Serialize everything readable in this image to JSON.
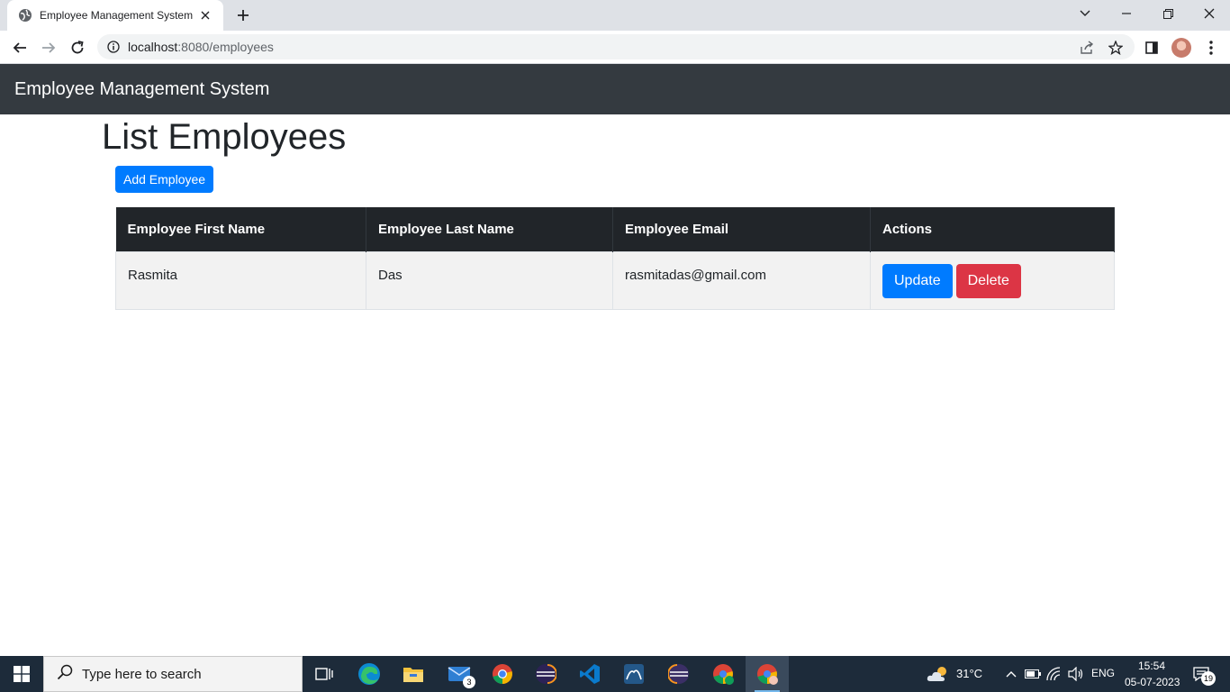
{
  "browser": {
    "tab_title": "Employee Management System",
    "url_host": "localhost",
    "url_path": ":8080/employees"
  },
  "page": {
    "brand": "Employee Management System",
    "title": "List Employees",
    "add_button": "Add Employee",
    "table": {
      "headers": [
        "Employee First Name",
        "Employee Last Name",
        "Employee Email",
        "Actions"
      ],
      "rows": [
        {
          "first_name": "Rasmita",
          "last_name": "Das",
          "email": "rasmitadas@gmail.com",
          "update_label": "Update",
          "delete_label": "Delete"
        }
      ]
    }
  },
  "taskbar": {
    "search_placeholder": "Type here to search",
    "mail_badge": "3",
    "weather": "31°C",
    "language": "ENG",
    "time": "15:54",
    "date": "05-07-2023",
    "notification_count": "19"
  },
  "colors": {
    "navbar": "#343a40",
    "primary": "#007bff",
    "danger": "#dc3545",
    "table_header": "#212529"
  }
}
